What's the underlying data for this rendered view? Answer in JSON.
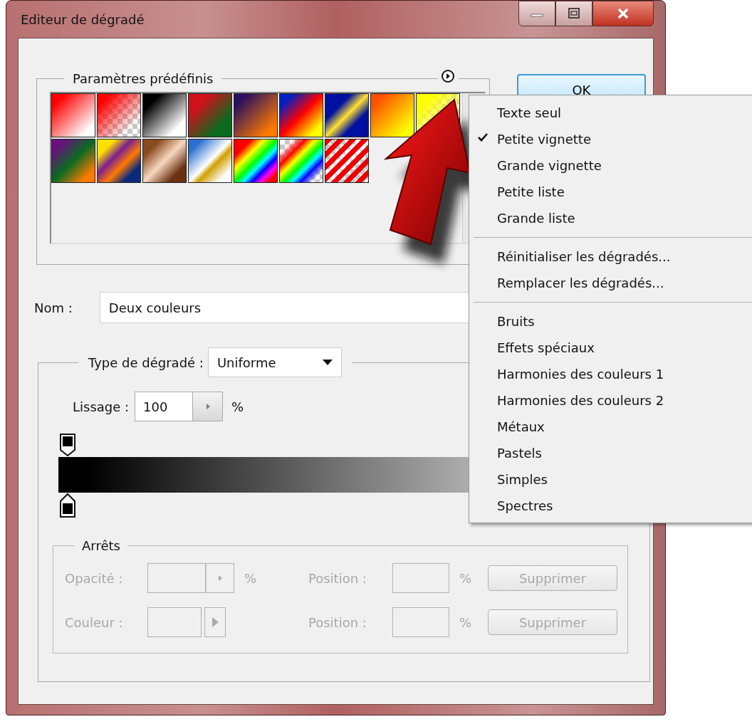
{
  "window": {
    "title": "Editeur de dégradé"
  },
  "presets": {
    "legend": "Paramètres prédéfinis"
  },
  "ok_button": {
    "label": "OK"
  },
  "menu": {
    "items": [
      {
        "kind": "item",
        "label": "Texte seul",
        "checked": false
      },
      {
        "kind": "item",
        "label": "Petite vignette",
        "checked": true
      },
      {
        "kind": "item",
        "label": "Grande vignette",
        "checked": false
      },
      {
        "kind": "item",
        "label": "Petite liste",
        "checked": false
      },
      {
        "kind": "item",
        "label": "Grande liste",
        "checked": false
      },
      {
        "kind": "separator"
      },
      {
        "kind": "item",
        "label": "Réinitialiser les dégradés...",
        "checked": false
      },
      {
        "kind": "item",
        "label": "Remplacer les dégradés...",
        "checked": false
      },
      {
        "kind": "separator"
      },
      {
        "kind": "item",
        "label": "Bruits",
        "checked": false
      },
      {
        "kind": "item",
        "label": "Effets spéciaux",
        "checked": false
      },
      {
        "kind": "item",
        "label": "Harmonies des couleurs 1",
        "checked": false
      },
      {
        "kind": "item",
        "label": "Harmonies des couleurs 2",
        "checked": false
      },
      {
        "kind": "item",
        "label": "Métaux",
        "checked": false
      },
      {
        "kind": "item",
        "label": "Pastels",
        "checked": false
      },
      {
        "kind": "item",
        "label": "Simples",
        "checked": false
      },
      {
        "kind": "item",
        "label": "Spectres",
        "checked": false
      }
    ]
  },
  "name_field": {
    "label": "Nom :",
    "value": "Deux couleurs"
  },
  "gradient_type": {
    "label": "Type de dégradé :",
    "value": "Uniforme"
  },
  "smoothness": {
    "label": "Lissage :",
    "value": "100",
    "unit": "%"
  },
  "stops": {
    "legend": "Arrêts",
    "rows": [
      {
        "kind": "opacity",
        "label": "Opacité :",
        "unit": "%",
        "position_label": "Position :",
        "position_unit": "%",
        "button": "Supprimer",
        "disabled": true
      },
      {
        "kind": "color",
        "label": "Couleur :",
        "unit": "",
        "position_label": "Position :",
        "position_unit": "%",
        "button": "Supprimer",
        "disabled": true
      }
    ]
  }
}
